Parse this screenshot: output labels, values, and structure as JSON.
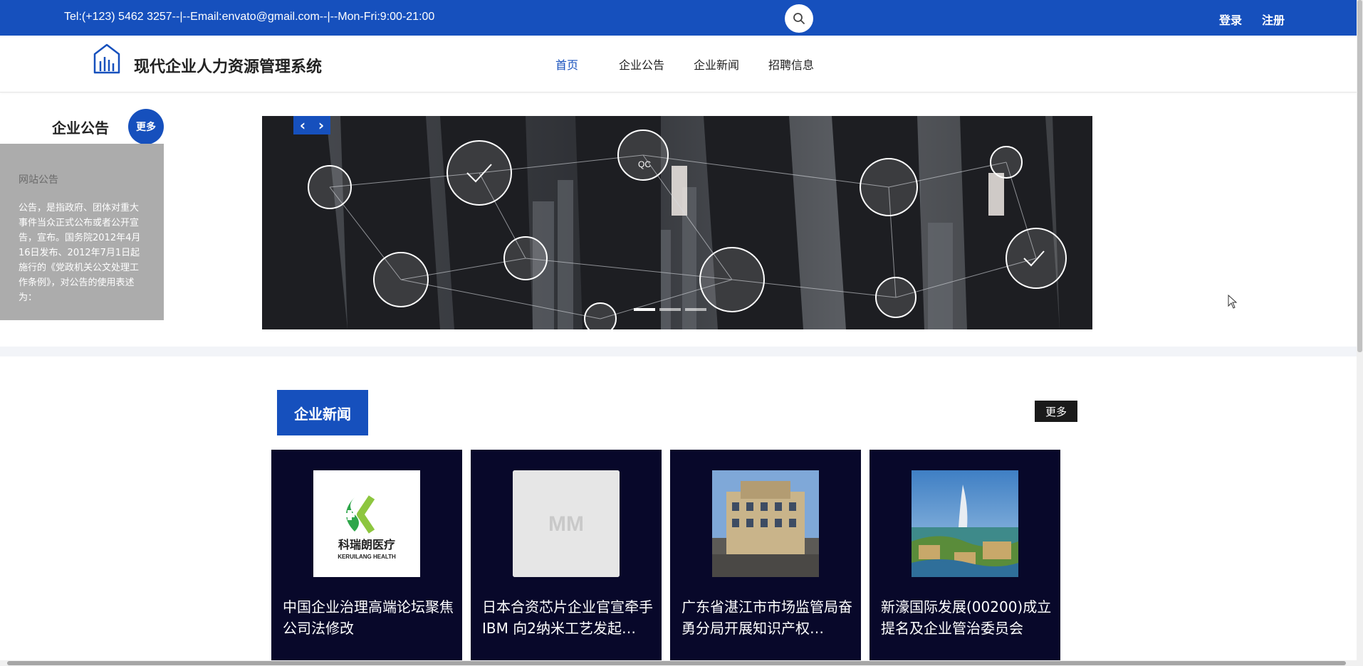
{
  "topbar": {
    "contact": "Tel:(+123) 5462 3257--|--Email:envato@gmail.com--|--Mon-Fri:9:00-21:00",
    "login": "登录",
    "register": "注册",
    "search_icon": "search-icon"
  },
  "header": {
    "title": "现代企业人力资源管理系统",
    "logo_icon": "building-chart-icon",
    "nav": [
      "首页",
      "企业公告",
      "企业新闻",
      "招聘信息"
    ]
  },
  "notice": {
    "heading": "企业公告",
    "more": "更多",
    "box_title": "网站公告",
    "box_text": "公告，是指政府、团体对重大事件当众正式公布或者公开宣告，宣布。国务院2012年4月16日发布、2012年7月1日起施行的《党政机关公文处理工作条例》，对公告的使用表述为："
  },
  "carousel": {
    "prev_icon": "chevron-left-icon",
    "next_icon": "chevron-right-icon",
    "slides": 3,
    "active_slide": 1
  },
  "news": {
    "heading": "企业新闻",
    "more": "更多",
    "cards": [
      {
        "text": "中国企业治理高端论坛聚焦公司法修改",
        "thumb": "logo",
        "logo_cn": "科瑞朗医疗",
        "logo_en": "KERUILANG HEALTH"
      },
      {
        "text": "日本合资芯片企业官宣牵手IBM 向2纳米工艺发起…",
        "thumb": "placeholder",
        "placeholder": "MM"
      },
      {
        "text": "广东省湛江市市场监管局奋勇分局开展知识产权…",
        "thumb": "building"
      },
      {
        "text": "新濠国际发展(00200)成立提名及企业管治委员会",
        "thumb": "resort"
      }
    ]
  },
  "colors": {
    "primary": "#1650bd",
    "card_bg": "#08082a",
    "notice_bg": "#acacac"
  }
}
